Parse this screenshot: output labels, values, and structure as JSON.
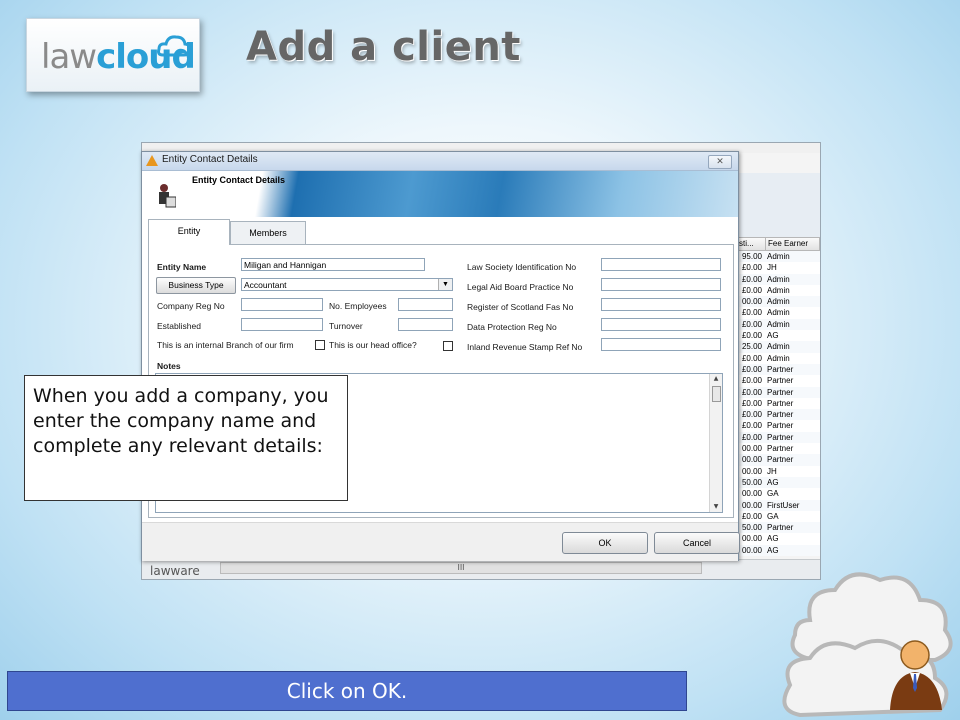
{
  "slide": {
    "title": "Add a client",
    "logo": {
      "part1": "law",
      "part2": "cloud"
    }
  },
  "background_app": {
    "status_logo": "lawware",
    "hscroll_mark": "III",
    "fee_table": {
      "headers": [
        "sti...",
        "Fee Earner"
      ],
      "rows": [
        [
          "95.00",
          "Admin"
        ],
        [
          "£0.00",
          "JH"
        ],
        [
          "£0.00",
          "Admin"
        ],
        [
          "£0.00",
          "Admin"
        ],
        [
          "00.00",
          "Admin"
        ],
        [
          "£0.00",
          "Admin"
        ],
        [
          "£0.00",
          "Admin"
        ],
        [
          "£0.00",
          "AG"
        ],
        [
          "25.00",
          "Admin"
        ],
        [
          "£0.00",
          "Admin"
        ],
        [
          "£0.00",
          "Partner"
        ],
        [
          "£0.00",
          "Partner"
        ],
        [
          "£0.00",
          "Partner"
        ],
        [
          "£0.00",
          "Partner"
        ],
        [
          "£0.00",
          "Partner"
        ],
        [
          "£0.00",
          "Partner"
        ],
        [
          "£0.00",
          "Partner"
        ],
        [
          "00.00",
          "Partner"
        ],
        [
          "00.00",
          "Partner"
        ],
        [
          "00.00",
          "JH"
        ],
        [
          "50.00",
          "AG"
        ],
        [
          "00.00",
          "GA"
        ],
        [
          "00.00",
          "FirstUser"
        ],
        [
          "£0.00",
          "GA"
        ],
        [
          "50.00",
          "Partner"
        ],
        [
          "00.00",
          "AG"
        ],
        [
          "00.00",
          "AG"
        ]
      ]
    }
  },
  "dialog": {
    "title": "Entity Contact Details",
    "banner_title": "Entity Contact Details",
    "close_glyph": "✕",
    "tabs": [
      "Entity",
      "Members"
    ],
    "fields": {
      "entity_name_label": "Entity Name",
      "entity_name_value": "Miligan and Hannigan",
      "business_type_button": "Business Type",
      "business_type_value": "Accountant",
      "company_reg_label": "Company Reg No",
      "employees_label": "No. Employees",
      "established_label": "Established",
      "turnover_label": "Turnover",
      "internal_branch_label": "This is an internal Branch of our firm",
      "head_office_label": "This is our head office?",
      "law_society_label": "Law Society Identification No",
      "legal_aid_label": "Legal Aid Board Practice No",
      "register_scotland_label": "Register of Scotland Fas No",
      "data_protection_label": "Data Protection Reg No",
      "inland_revenue_label": "Inland Revenue Stamp Ref No",
      "notes_label": "Notes"
    },
    "buttons": {
      "ok": "OK",
      "cancel": "Cancel"
    }
  },
  "callout": {
    "text": "When you add a company, you enter the company name and complete any relevant details:"
  },
  "instruction": "Click on OK."
}
